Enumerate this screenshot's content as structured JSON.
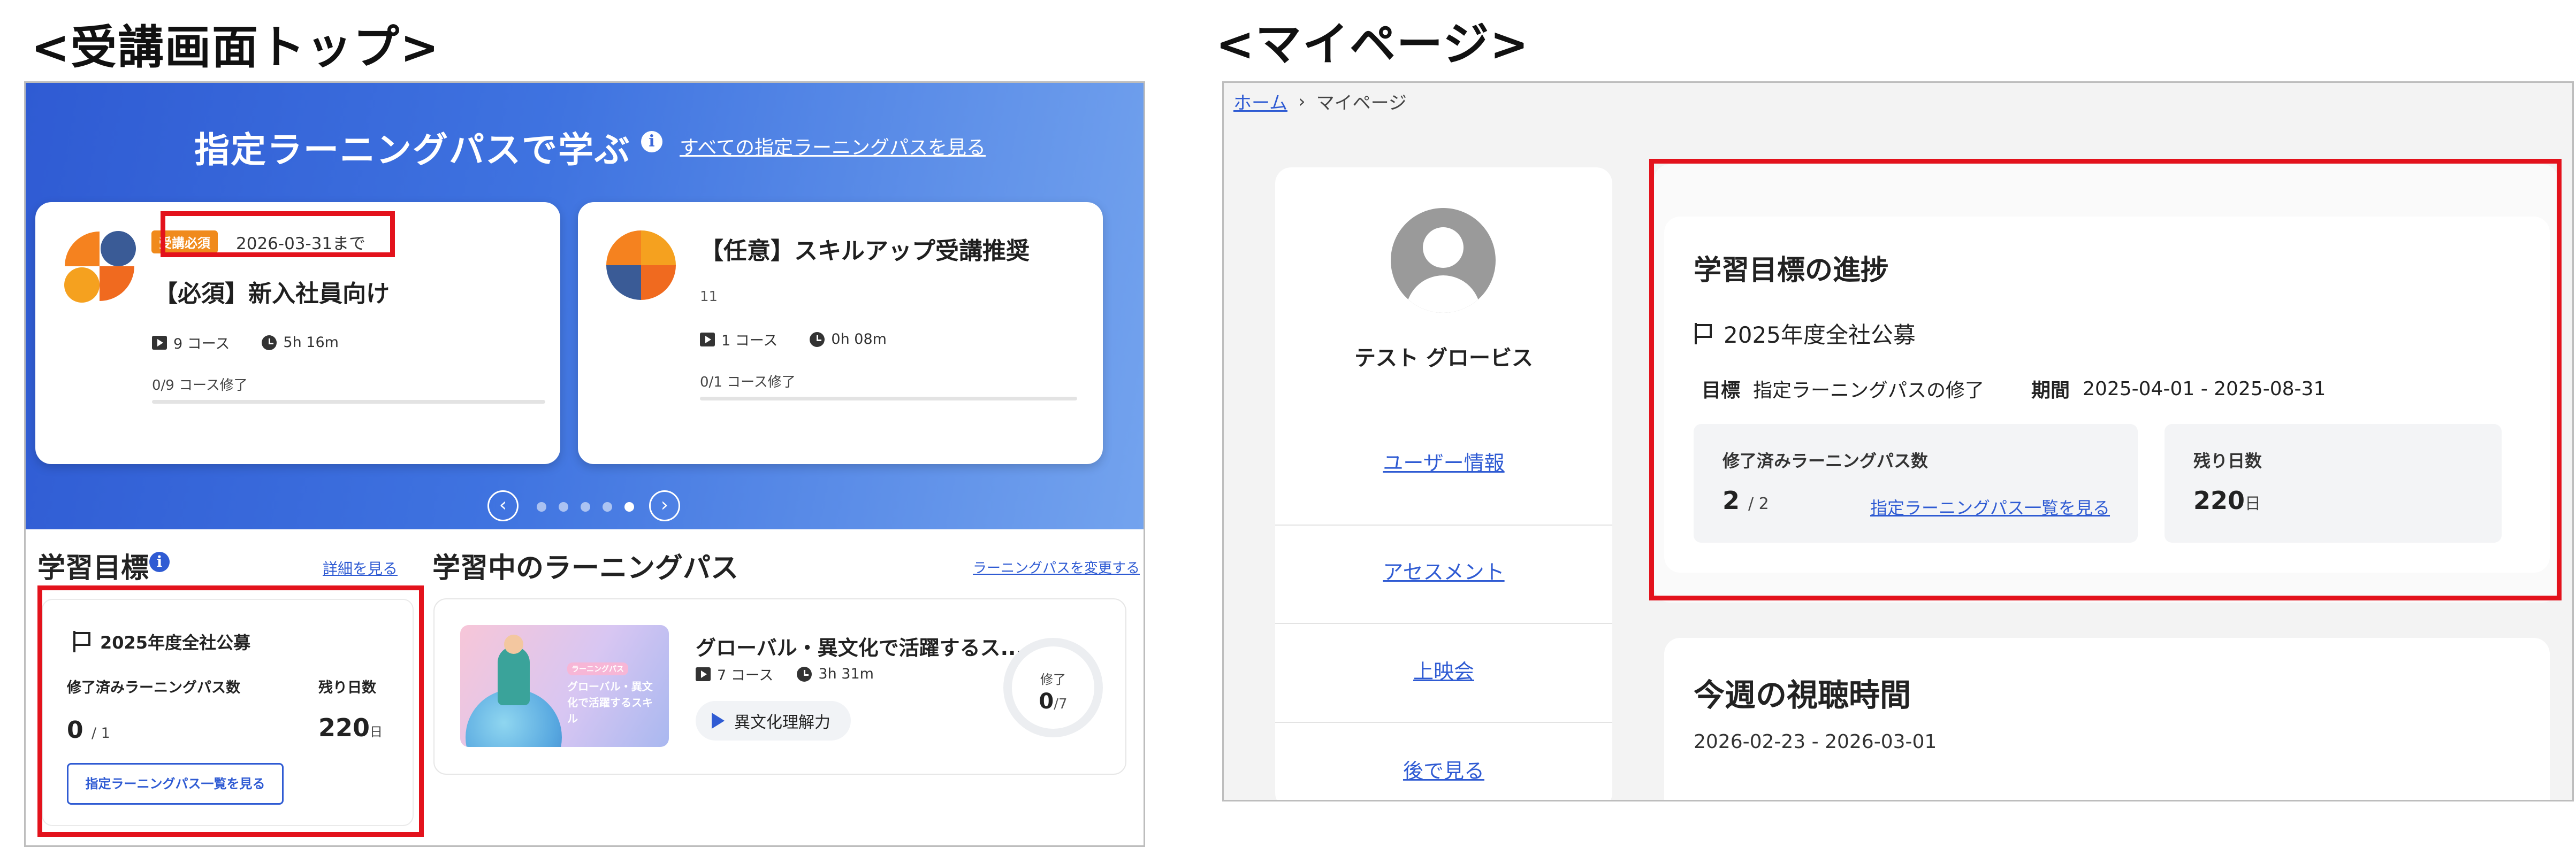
{
  "headings": {
    "left": "<受講画面トップ>",
    "right": "<マイページ>"
  },
  "left": {
    "hero": {
      "title": "指定ラーニングパスで学ぶ",
      "info_icon": "info-icon",
      "all_link": "すべての指定ラーニングパスを見る"
    },
    "cards": [
      {
        "badge": "受講必須",
        "due": "2026-03-31まで",
        "title": "【必須】新入社員向け",
        "subtitle": "",
        "courses": "9 コース",
        "duration": "5h 16m",
        "progress": "0/9 コース修了",
        "progress_fraction": 0
      },
      {
        "badge": "",
        "due": "",
        "title": "【任意】スキルアップ受講推奨",
        "subtitle": "11",
        "courses": "1 コース",
        "duration": "0h 08m",
        "progress": "0/1 コース修了",
        "progress_fraction": 0
      }
    ],
    "carousel": {
      "prev": "‹",
      "next": "›",
      "dots": 5,
      "active_dot": 4
    },
    "goal": {
      "heading": "学習目標",
      "detail_link": "詳細を見る",
      "name": "2025年度全社公募",
      "completed_label": "修了済みラーニングパス数",
      "completed_value": "0",
      "completed_total": "/ 1",
      "remaining_label": "残り日数",
      "remaining_value": "220",
      "remaining_unit": "日",
      "list_button": "指定ラーニングパス一覧を見る"
    },
    "learning": {
      "heading": "学習中のラーニングパス",
      "change_link": "ラーニングパスを変更する",
      "course_title": "グローバル・異文化で活躍するス...",
      "courses": "7 コース",
      "duration": "3h 31m",
      "play_label": "異文化理解力",
      "thumb_badge": "ラーニングパス",
      "thumb_text": "グローバル・異文化で活躍するスキル",
      "ring_label": "修了",
      "ring_value": "0",
      "ring_total": "/7",
      "ring_fraction": 0
    }
  },
  "right": {
    "breadcrumb": {
      "home": "ホーム",
      "separator": "›",
      "current": "マイページ"
    },
    "sidebar": {
      "user_name": "テスト グロービス",
      "links": [
        "ユーザー情報",
        "アセスメント",
        "上映会",
        "後で見る"
      ]
    },
    "progress": {
      "title": "学習目標の進捗",
      "goal_name": "2025年度全社公募",
      "target_label": "目標",
      "target_value": "指定ラーニングパスの修了",
      "period_label": "期間",
      "period_value": "2025-04-01 - 2025-08-31",
      "completed_label": "修了済みラーニングパス数",
      "completed_value": "2",
      "completed_total": "/ 2",
      "list_link": "指定ラーニングパス一覧を見る",
      "remaining_label": "残り日数",
      "remaining_value": "220",
      "remaining_unit": "日"
    },
    "week": {
      "title": "今週の視聴時間",
      "range": "2026-02-23 - 2026-03-01"
    }
  },
  "colors": {
    "accent": "#2f5bd3",
    "badge": "#f08a1c",
    "highlight": "#e3121c"
  }
}
